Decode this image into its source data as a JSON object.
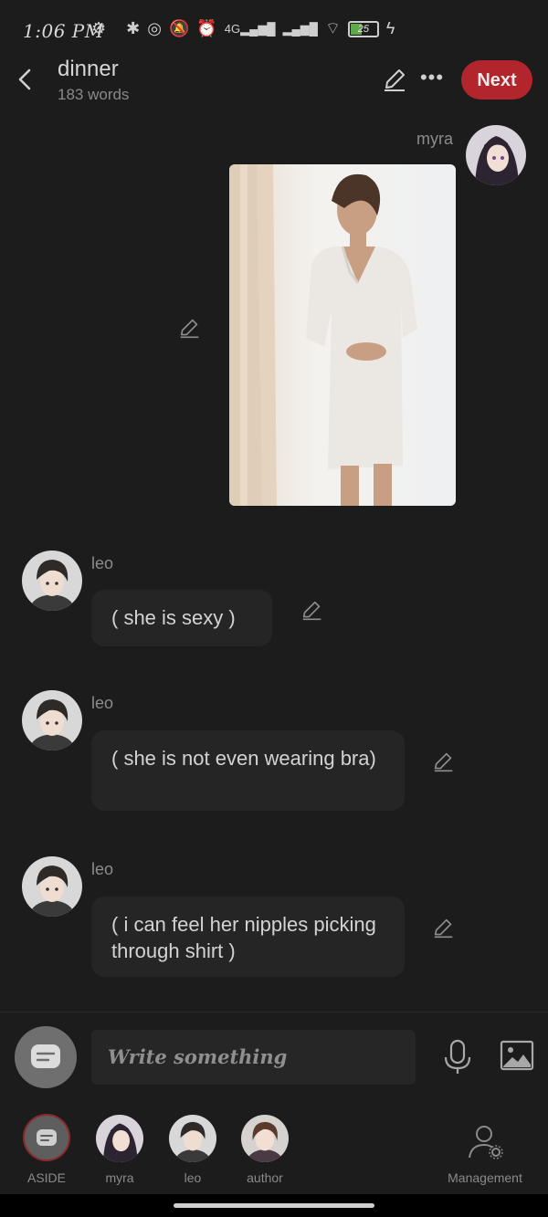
{
  "status": {
    "time": "1:06 PM",
    "battery": "25"
  },
  "header": {
    "title": "dinner",
    "word_count": "183 words",
    "next_label": "Next"
  },
  "messages": [
    {
      "speaker": "myra",
      "type": "image"
    },
    {
      "speaker": "leo",
      "text": "( she is  sexy )"
    },
    {
      "speaker": "leo",
      "text": "( she is not even wearing bra)"
    },
    {
      "speaker": "leo",
      "text": "( i can feel her nipples picking through shirt )"
    }
  ],
  "composer": {
    "placeholder": "Write something"
  },
  "nav": {
    "items": [
      {
        "label": "ASIDE"
      },
      {
        "label": "myra"
      },
      {
        "label": "leo"
      },
      {
        "label": "author"
      },
      {
        "label": "Management"
      }
    ]
  },
  "colors": {
    "accent": "#b3252c",
    "background": "#1c1c1c",
    "bubble": "#252525"
  }
}
